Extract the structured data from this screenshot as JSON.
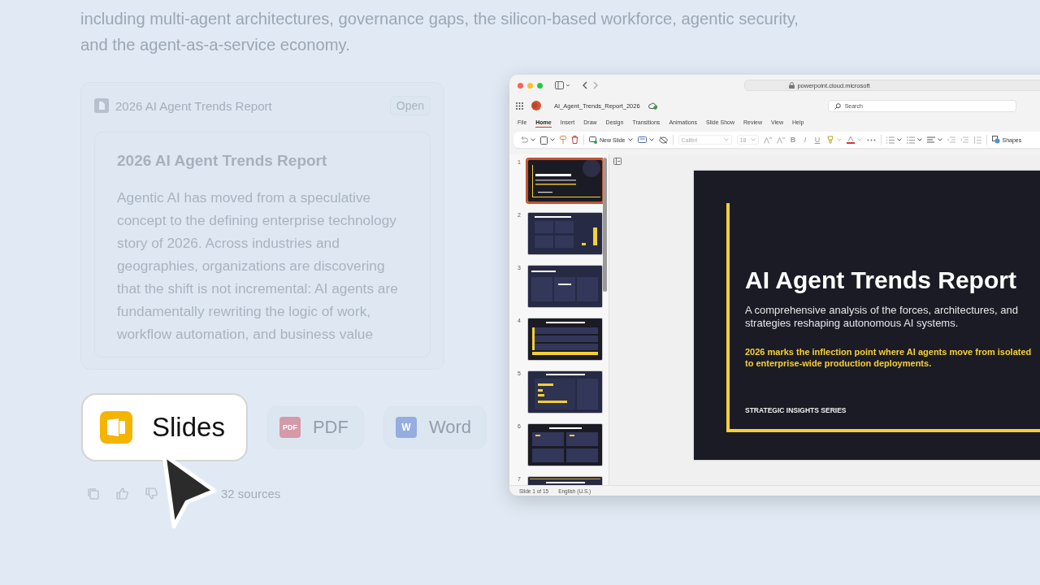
{
  "intro_text": "including multi-agent architectures, governance gaps, the silicon-based workforce, agentic security, and the agent-as-a-service economy.",
  "document_card": {
    "title": "2026 AI Agent Trends Report",
    "open_button": "Open",
    "preview": {
      "title": "2026 AI Agent Trends Report",
      "body": "Agentic AI has moved from a speculative concept to the defining enterprise technology story of 2026. Across industries and geographies, organizations are discovering that the shift is not incremental: AI agents are fundamentally rewriting the logic of work, workflow automation, and business value"
    }
  },
  "export_options": [
    {
      "kind": "slides",
      "label": "Slides",
      "selected": true
    },
    {
      "kind": "pdf",
      "label": "PDF",
      "icon_text": "PDF",
      "selected": false
    },
    {
      "kind": "word",
      "label": "Word",
      "icon_text": "W",
      "selected": false
    }
  ],
  "feedback": {
    "sources": "32 sources"
  },
  "browser": {
    "url": "powerpoint.cloud.microsoft"
  },
  "app": {
    "filename": "AI_Agent_Trends_Report_2026",
    "search": {
      "placeholder": "Search"
    },
    "tabs": [
      {
        "label": "File",
        "selected": false
      },
      {
        "label": "Home",
        "selected": true
      },
      {
        "label": "Insert",
        "selected": false
      },
      {
        "label": "Draw",
        "selected": false
      },
      {
        "label": "Design",
        "selected": false
      },
      {
        "label": "Transitions",
        "selected": false
      },
      {
        "label": "Animations",
        "selected": false
      },
      {
        "label": "Slide Show",
        "selected": false
      },
      {
        "label": "Review",
        "selected": false
      },
      {
        "label": "View",
        "selected": false
      },
      {
        "label": "Help",
        "selected": false
      }
    ],
    "toolbar": {
      "new_slide": "New Slide",
      "font": "Calibri",
      "font_size": "18",
      "format_buttons": [
        "B",
        "I",
        "U"
      ],
      "shapes": "Shapes"
    },
    "thumbnails": [
      {
        "number": "1",
        "selected": true
      },
      {
        "number": "2",
        "selected": false
      },
      {
        "number": "3",
        "selected": false
      },
      {
        "number": "4",
        "selected": false
      },
      {
        "number": "5",
        "selected": false
      },
      {
        "number": "6",
        "selected": false
      },
      {
        "number": "7",
        "selected": false
      }
    ],
    "slide": {
      "title": "AI Agent Trends Report",
      "subtitle": "A comprehensive analysis of the forces, architectures, and strategies reshaping autonomous AI systems.",
      "highlight_lines": [
        "2026 marks the inflection point where AI agents move from isolated",
        "to enterprise-wide production deployments."
      ],
      "series": "STRATEGIC INSIGHTS SERIES"
    },
    "status_bar": {
      "slide_position": "Slide 1 of 15",
      "language": "English (U.S.)"
    }
  }
}
